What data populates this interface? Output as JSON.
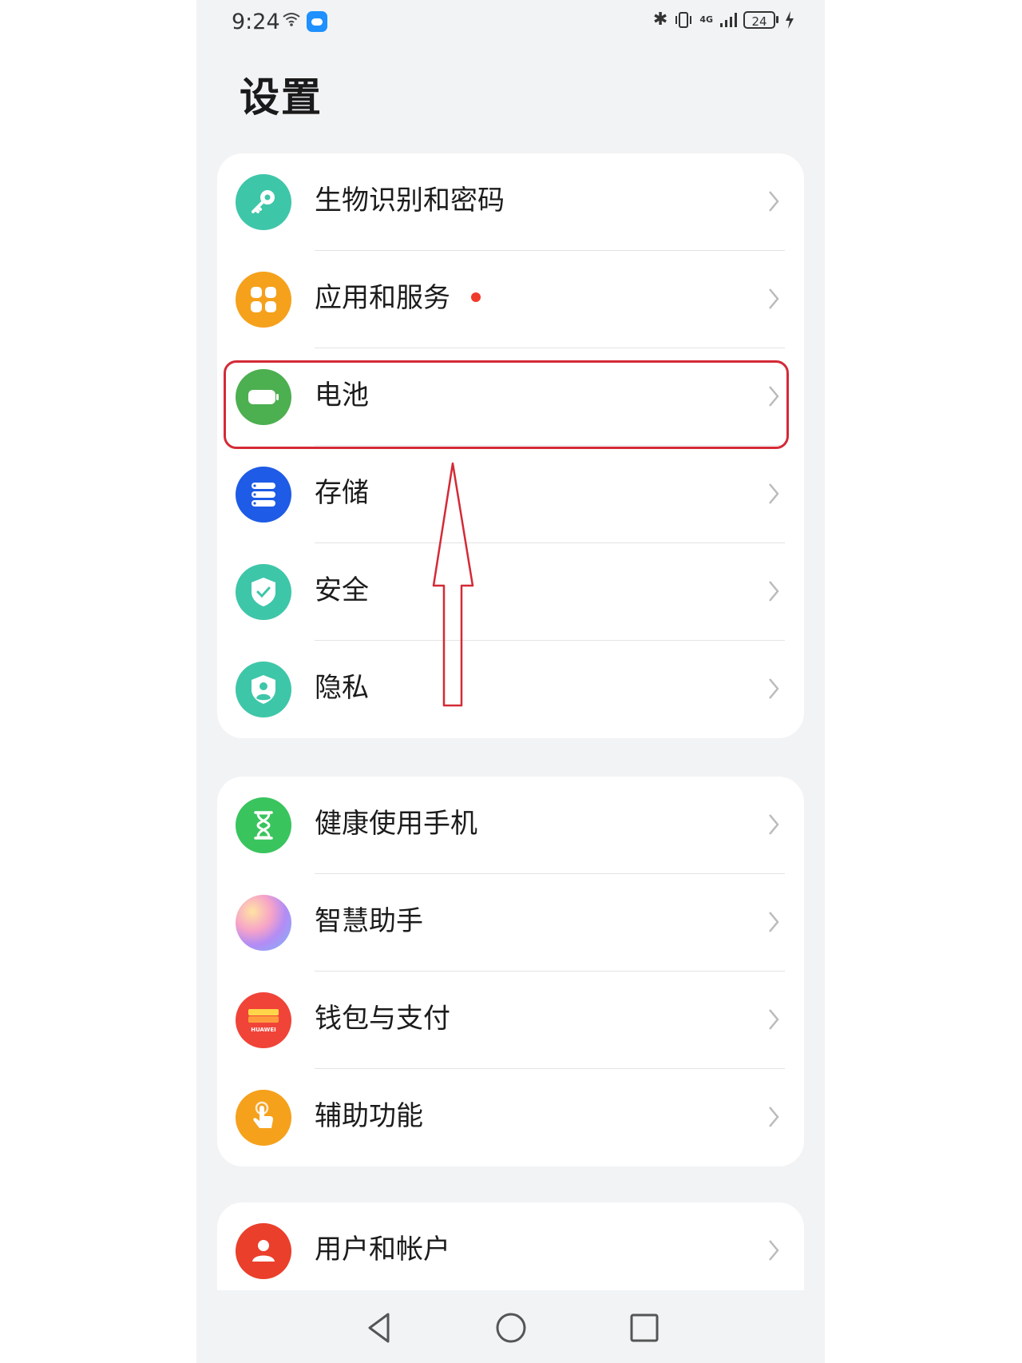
{
  "status_bar": {
    "time": "9:24",
    "network": "4G",
    "battery_level": "24"
  },
  "header": {
    "title": "设置"
  },
  "groups": [
    {
      "items": [
        {
          "label": "生物识别和密码",
          "icon": "key-icon",
          "color": "#3ec6a9"
        },
        {
          "label": "应用和服务",
          "icon": "apps-grid-icon",
          "color": "#f5a11c",
          "badge_dot": true
        },
        {
          "label": "电池",
          "icon": "battery-icon",
          "color": "#4caf50"
        },
        {
          "label": "存储",
          "icon": "storage-icon",
          "color": "#1e5be6"
        },
        {
          "label": "安全",
          "icon": "shield-check-icon",
          "color": "#3ec6a9"
        },
        {
          "label": "隐私",
          "icon": "privacy-shield-icon",
          "color": "#3ec6a9"
        }
      ]
    },
    {
      "items": [
        {
          "label": "健康使用手机",
          "icon": "hourglass-icon",
          "color": "#39c45e"
        },
        {
          "label": "智慧助手",
          "icon": "assistant-orb-icon",
          "color": "#c58cf0"
        },
        {
          "label": "钱包与支付",
          "icon": "wallet-icon",
          "color": "#f04438",
          "icon_text": "HUAWEI"
        },
        {
          "label": "辅助功能",
          "icon": "hand-touch-icon",
          "color": "#f5a11c"
        }
      ]
    },
    {
      "items": [
        {
          "label": "用户和帐户",
          "icon": "user-icon",
          "color": "#ea3f2b"
        }
      ]
    }
  ],
  "annotation": {
    "highlighted_item": "电池",
    "color": "#d42a36"
  }
}
